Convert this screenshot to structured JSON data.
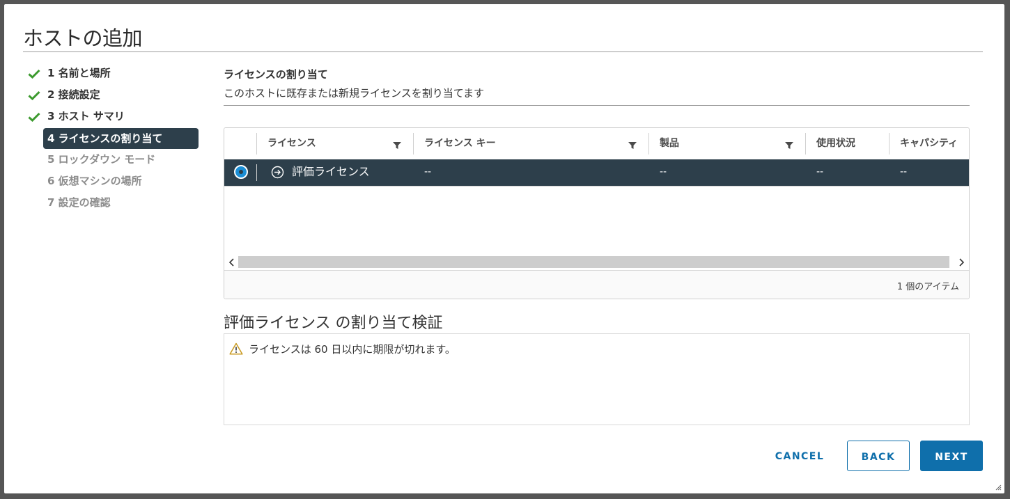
{
  "dialog": {
    "title": "ホストの追加"
  },
  "steps": [
    {
      "label": "1 名前と場所",
      "state": "done"
    },
    {
      "label": "2 接続設定",
      "state": "done"
    },
    {
      "label": "3 ホスト サマリ",
      "state": "done"
    },
    {
      "label": "4 ライセンスの割り当て",
      "state": "current"
    },
    {
      "label": "5 ロックダウン モード",
      "state": "future"
    },
    {
      "label": "6 仮想マシンの場所",
      "state": "future"
    },
    {
      "label": "7 設定の確認",
      "state": "future"
    }
  ],
  "main": {
    "title": "ライセンスの割り当て",
    "description": "このホストに既存または新規ライセンスを割り当てます",
    "grid": {
      "columns": [
        "ライセンス",
        "ライセンス キー",
        "製品",
        "使用状況",
        "キャパシティ"
      ],
      "rows": [
        {
          "license": "評価ライセンス",
          "key": "--",
          "product": "--",
          "usage": "--",
          "capacity": "--",
          "selected": true
        }
      ],
      "footer": "1 個のアイテム"
    },
    "validation": {
      "title": "評価ライセンス の割り当て検証",
      "message": "ライセンスは 60 日以内に期限が切れます。"
    }
  },
  "buttons": {
    "cancel": "CANCEL",
    "back": "BACK",
    "next": "NEXT"
  },
  "colors": {
    "accent": "#0f6fab",
    "selected_row": "#2d3f4b",
    "check": "#3c9a2e",
    "warning": "#c99a20"
  },
  "icons": [
    "check-icon",
    "filter-icon",
    "radio-selected-icon",
    "expand-arrow-icon",
    "chevron-left-icon",
    "chevron-right-icon",
    "warning-icon",
    "resize-handle-icon"
  ]
}
